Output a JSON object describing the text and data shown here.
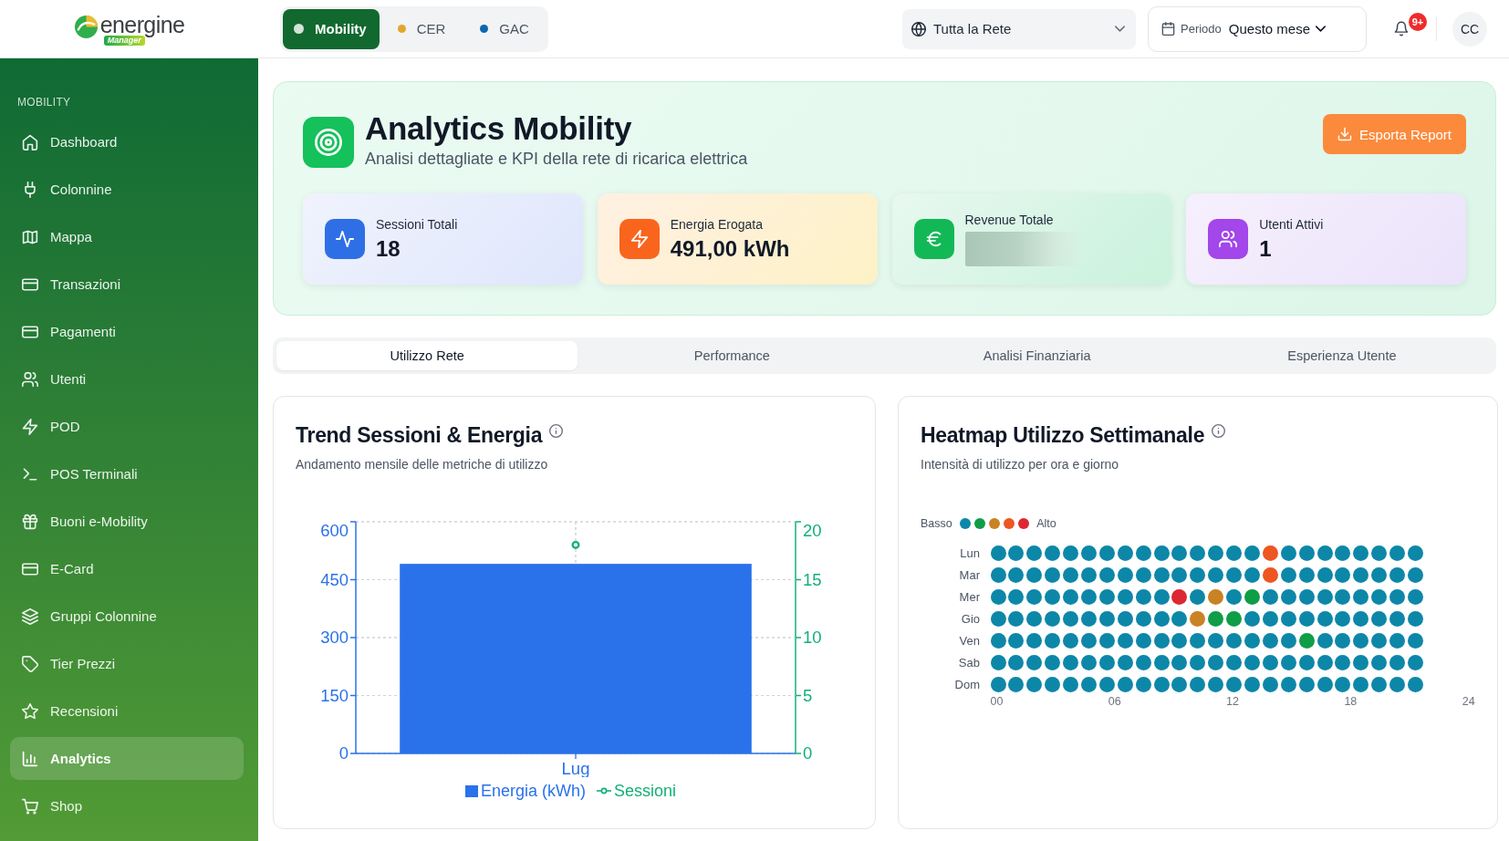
{
  "header": {
    "logo": {
      "wordmark": "energine",
      "tagline": "Manager"
    },
    "domain_tabs": [
      {
        "label": "Mobility",
        "selected": true,
        "color": "#d5e3d9"
      },
      {
        "label": "CER",
        "selected": false,
        "color": "#e3a62b"
      },
      {
        "label": "GAC",
        "selected": false,
        "color": "#0d67ad"
      }
    ],
    "network_select": {
      "value": "Tutta la Rete"
    },
    "period_select": {
      "label": "Periodo",
      "value": "Questo mese"
    },
    "notifications": {
      "badge": "9+"
    },
    "avatar": {
      "initials": "CC"
    }
  },
  "sidebar": {
    "section": "MOBILITY",
    "items": [
      {
        "label": "Dashboard",
        "selected": false
      },
      {
        "label": "Colonnine",
        "selected": false
      },
      {
        "label": "Mappa",
        "selected": false
      },
      {
        "label": "Transazioni",
        "selected": false
      },
      {
        "label": "Pagamenti",
        "selected": false
      },
      {
        "label": "Utenti",
        "selected": false
      },
      {
        "label": "POD",
        "selected": false
      },
      {
        "label": "POS Terminali",
        "selected": false
      },
      {
        "label": "Buoni e-Mobility",
        "selected": false
      },
      {
        "label": "E-Card",
        "selected": false
      },
      {
        "label": "Gruppi Colonnine",
        "selected": false
      },
      {
        "label": "Tier Prezzi",
        "selected": false
      },
      {
        "label": "Recensioni",
        "selected": false
      },
      {
        "label": "Analytics",
        "selected": true
      },
      {
        "label": "Shop",
        "selected": false
      }
    ]
  },
  "page_header": {
    "title": "Analytics Mobility",
    "subtitle": "Analisi dettagliate e KPI della rete di ricarica elettrica",
    "export_button": "Esporta Report"
  },
  "kpis": [
    {
      "label": "Sessioni Totali",
      "value": "18",
      "redacted": false,
      "color": "#2f6fe6"
    },
    {
      "label": "Energia Erogata",
      "value": "491,00 kWh",
      "redacted": false,
      "color": "#f9651d"
    },
    {
      "label": "Revenue Totale",
      "redacted": true,
      "color": "#13b856"
    },
    {
      "label": "Utenti Attivi",
      "value": "1",
      "redacted": false,
      "color": "#a346ea"
    }
  ],
  "analytics_tabs": [
    {
      "label": "Utilizzo Rete",
      "selected": true
    },
    {
      "label": "Performance",
      "selected": false
    },
    {
      "label": "Analisi Finanziaria",
      "selected": false
    },
    {
      "label": "Esperienza Utente",
      "selected": false
    }
  ],
  "trend_card": {
    "title": "Trend Sessioni & Energia",
    "subtitle": "Andamento mensile delle metriche di utilizzo",
    "energy_axis": {
      "chart_data": {
        "type": "bar",
        "categories": [
          "Lug"
        ],
        "series": [
          {
            "name": "Energia (kWh)",
            "color": "#2a72ea",
            "values": [
              491
            ]
          }
        ],
        "ylim": [
          0,
          600
        ],
        "yticks": [
          0,
          150,
          300,
          450,
          600
        ],
        "grid": true
      }
    },
    "sessions_axis": {
      "chart_data": {
        "type": "line",
        "series": [
          {
            "name": "Sessioni",
            "color": "#12b076",
            "marker": "circle",
            "values": [
              18
            ]
          }
        ],
        "ylim": [
          0,
          20
        ],
        "yticks": [
          0,
          5,
          10,
          15,
          20
        ],
        "grid": true
      }
    }
  },
  "heatmap_card": {
    "title": "Heatmap Utilizzo Settimanale",
    "subtitle": "Intensità di utilizzo per ora e giorno",
    "legend": {
      "low": "Basso",
      "high": "Alto",
      "colors": [
        {
          "color": "#0d87a8"
        },
        {
          "color": "#0f9d48"
        },
        {
          "color": "#c98224"
        },
        {
          "color": "#ee5622"
        },
        {
          "color": "#dc2832"
        }
      ]
    },
    "rows": [
      {
        "day": "Lun",
        "cells": [
          {
            "color": "#0d87a8"
          },
          {
            "color": "#0d87a8"
          },
          {
            "color": "#0d87a8"
          },
          {
            "color": "#0d87a8"
          },
          {
            "color": "#0d87a8"
          },
          {
            "color": "#0d87a8"
          },
          {
            "color": "#0d87a8"
          },
          {
            "color": "#0d87a8"
          },
          {
            "color": "#0d87a8"
          },
          {
            "color": "#0d87a8"
          },
          {
            "color": "#0d87a8"
          },
          {
            "color": "#0d87a8"
          },
          {
            "color": "#0d87a8"
          },
          {
            "color": "#0d87a8"
          },
          {
            "color": "#0d87a8"
          },
          {
            "color": "#ee5622"
          },
          {
            "color": "#0d87a8"
          },
          {
            "color": "#0d87a8"
          },
          {
            "color": "#0d87a8"
          },
          {
            "color": "#0d87a8"
          },
          {
            "color": "#0d87a8"
          },
          {
            "color": "#0d87a8"
          },
          {
            "color": "#0d87a8"
          },
          {
            "color": "#0d87a8"
          }
        ]
      },
      {
        "day": "Mar",
        "cells": [
          {
            "color": "#0d87a8"
          },
          {
            "color": "#0d87a8"
          },
          {
            "color": "#0d87a8"
          },
          {
            "color": "#0d87a8"
          },
          {
            "color": "#0d87a8"
          },
          {
            "color": "#0d87a8"
          },
          {
            "color": "#0d87a8"
          },
          {
            "color": "#0d87a8"
          },
          {
            "color": "#0d87a8"
          },
          {
            "color": "#0d87a8"
          },
          {
            "color": "#0d87a8"
          },
          {
            "color": "#0d87a8"
          },
          {
            "color": "#0d87a8"
          },
          {
            "color": "#0d87a8"
          },
          {
            "color": "#0d87a8"
          },
          {
            "color": "#ee5622"
          },
          {
            "color": "#0d87a8"
          },
          {
            "color": "#0d87a8"
          },
          {
            "color": "#0d87a8"
          },
          {
            "color": "#0d87a8"
          },
          {
            "color": "#0d87a8"
          },
          {
            "color": "#0d87a8"
          },
          {
            "color": "#0d87a8"
          },
          {
            "color": "#0d87a8"
          }
        ]
      },
      {
        "day": "Mer",
        "cells": [
          {
            "color": "#0d87a8"
          },
          {
            "color": "#0d87a8"
          },
          {
            "color": "#0d87a8"
          },
          {
            "color": "#0d87a8"
          },
          {
            "color": "#0d87a8"
          },
          {
            "color": "#0d87a8"
          },
          {
            "color": "#0d87a8"
          },
          {
            "color": "#0d87a8"
          },
          {
            "color": "#0d87a8"
          },
          {
            "color": "#0d87a8"
          },
          {
            "color": "#dc2832"
          },
          {
            "color": "#0d87a8"
          },
          {
            "color": "#c98224"
          },
          {
            "color": "#0d87a8"
          },
          {
            "color": "#0f9d48"
          },
          {
            "color": "#0d87a8"
          },
          {
            "color": "#0d87a8"
          },
          {
            "color": "#0d87a8"
          },
          {
            "color": "#0d87a8"
          },
          {
            "color": "#0d87a8"
          },
          {
            "color": "#0d87a8"
          },
          {
            "color": "#0d87a8"
          },
          {
            "color": "#0d87a8"
          },
          {
            "color": "#0d87a8"
          }
        ]
      },
      {
        "day": "Gio",
        "cells": [
          {
            "color": "#0d87a8"
          },
          {
            "color": "#0d87a8"
          },
          {
            "color": "#0d87a8"
          },
          {
            "color": "#0d87a8"
          },
          {
            "color": "#0d87a8"
          },
          {
            "color": "#0d87a8"
          },
          {
            "color": "#0d87a8"
          },
          {
            "color": "#0d87a8"
          },
          {
            "color": "#0d87a8"
          },
          {
            "color": "#0d87a8"
          },
          {
            "color": "#0d87a8"
          },
          {
            "color": "#c98224"
          },
          {
            "color": "#0f9d48"
          },
          {
            "color": "#0f9d48"
          },
          {
            "color": "#0d87a8"
          },
          {
            "color": "#0d87a8"
          },
          {
            "color": "#0d87a8"
          },
          {
            "color": "#0d87a8"
          },
          {
            "color": "#0d87a8"
          },
          {
            "color": "#0d87a8"
          },
          {
            "color": "#0d87a8"
          },
          {
            "color": "#0d87a8"
          },
          {
            "color": "#0d87a8"
          },
          {
            "color": "#0d87a8"
          }
        ]
      },
      {
        "day": "Ven",
        "cells": [
          {
            "color": "#0d87a8"
          },
          {
            "color": "#0d87a8"
          },
          {
            "color": "#0d87a8"
          },
          {
            "color": "#0d87a8"
          },
          {
            "color": "#0d87a8"
          },
          {
            "color": "#0d87a8"
          },
          {
            "color": "#0d87a8"
          },
          {
            "color": "#0d87a8"
          },
          {
            "color": "#0d87a8"
          },
          {
            "color": "#0d87a8"
          },
          {
            "color": "#0d87a8"
          },
          {
            "color": "#0d87a8"
          },
          {
            "color": "#0d87a8"
          },
          {
            "color": "#0d87a8"
          },
          {
            "color": "#0d87a8"
          },
          {
            "color": "#0d87a8"
          },
          {
            "color": "#0d87a8"
          },
          {
            "color": "#0f9d48"
          },
          {
            "color": "#0d87a8"
          },
          {
            "color": "#0d87a8"
          },
          {
            "color": "#0d87a8"
          },
          {
            "color": "#0d87a8"
          },
          {
            "color": "#0d87a8"
          },
          {
            "color": "#0d87a8"
          }
        ]
      },
      {
        "day": "Sab",
        "cells": [
          {
            "color": "#0d87a8"
          },
          {
            "color": "#0d87a8"
          },
          {
            "color": "#0d87a8"
          },
          {
            "color": "#0d87a8"
          },
          {
            "color": "#0d87a8"
          },
          {
            "color": "#0d87a8"
          },
          {
            "color": "#0d87a8"
          },
          {
            "color": "#0d87a8"
          },
          {
            "color": "#0d87a8"
          },
          {
            "color": "#0d87a8"
          },
          {
            "color": "#0d87a8"
          },
          {
            "color": "#0d87a8"
          },
          {
            "color": "#0d87a8"
          },
          {
            "color": "#0d87a8"
          },
          {
            "color": "#0d87a8"
          },
          {
            "color": "#0d87a8"
          },
          {
            "color": "#0d87a8"
          },
          {
            "color": "#0d87a8"
          },
          {
            "color": "#0d87a8"
          },
          {
            "color": "#0d87a8"
          },
          {
            "color": "#0d87a8"
          },
          {
            "color": "#0d87a8"
          },
          {
            "color": "#0d87a8"
          },
          {
            "color": "#0d87a8"
          }
        ]
      },
      {
        "day": "Dom",
        "cells": [
          {
            "color": "#0d87a8"
          },
          {
            "color": "#0d87a8"
          },
          {
            "color": "#0d87a8"
          },
          {
            "color": "#0d87a8"
          },
          {
            "color": "#0d87a8"
          },
          {
            "color": "#0d87a8"
          },
          {
            "color": "#0d87a8"
          },
          {
            "color": "#0d87a8"
          },
          {
            "color": "#0d87a8"
          },
          {
            "color": "#0d87a8"
          },
          {
            "color": "#0d87a8"
          },
          {
            "color": "#0d87a8"
          },
          {
            "color": "#0d87a8"
          },
          {
            "color": "#0d87a8"
          },
          {
            "color": "#0d87a8"
          },
          {
            "color": "#0d87a8"
          },
          {
            "color": "#0d87a8"
          },
          {
            "color": "#0d87a8"
          },
          {
            "color": "#0d87a8"
          },
          {
            "color": "#0d87a8"
          },
          {
            "color": "#0d87a8"
          },
          {
            "color": "#0d87a8"
          },
          {
            "color": "#0d87a8"
          },
          {
            "color": "#0d87a8"
          }
        ]
      }
    ],
    "xticks": [
      "00",
      "06",
      "12",
      "18",
      "24"
    ]
  }
}
